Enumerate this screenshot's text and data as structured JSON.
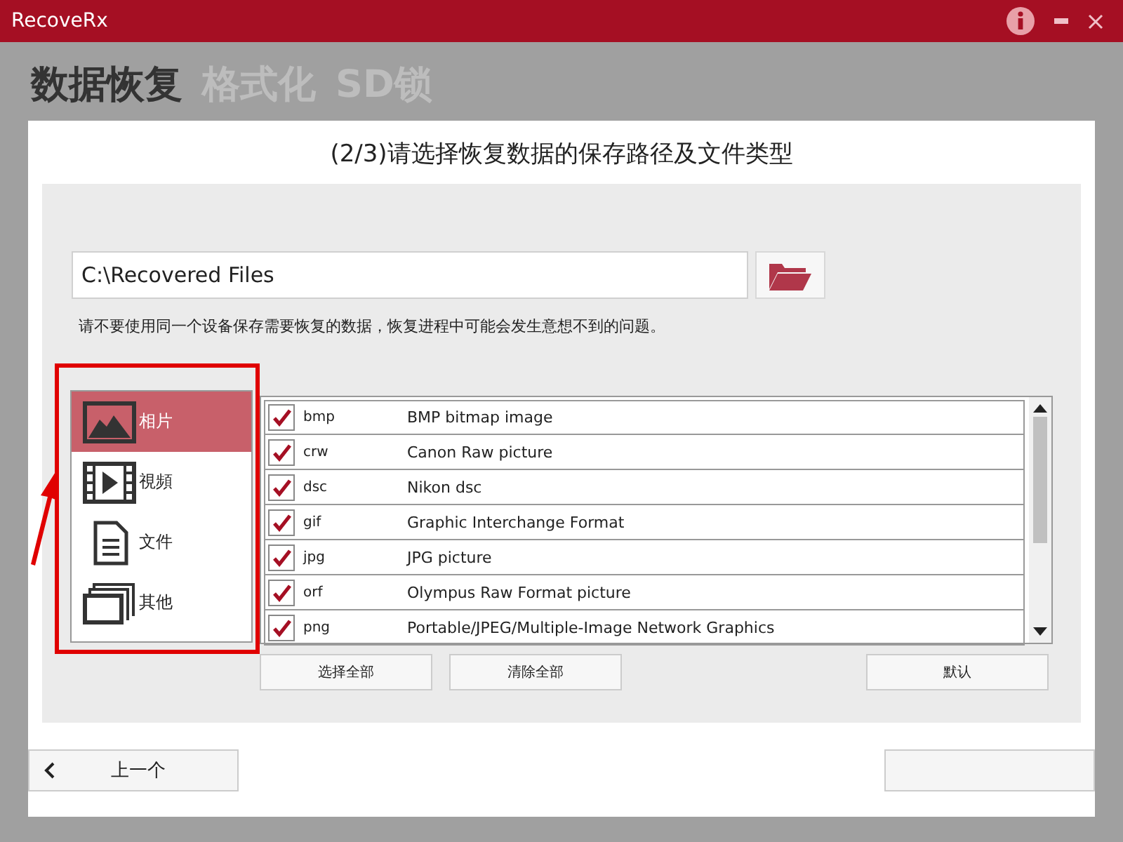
{
  "window": {
    "title": "RecoveRx"
  },
  "tabs": [
    {
      "label": "数据恢复",
      "selected": true
    },
    {
      "label": "格式化",
      "selected": false
    },
    {
      "label": "SD锁",
      "selected": false
    }
  ],
  "step_title": "(2/3)请选择恢复数据的保存路径及文件类型",
  "path_field": {
    "value": "C:\\Recovered Files"
  },
  "hint": "请不要使用同一个设备保存需要恢复的数据，恢复进程中可能会发生意想不到的问题。",
  "categories": [
    {
      "kind": "photo",
      "label": "相片",
      "selected": true
    },
    {
      "kind": "video",
      "label": "視頻",
      "selected": false
    },
    {
      "kind": "document",
      "label": "文件",
      "selected": false
    },
    {
      "kind": "other",
      "label": "其他",
      "selected": false
    }
  ],
  "file_types": [
    {
      "ext": "bmp",
      "description": "BMP bitmap image",
      "checked": true
    },
    {
      "ext": "crw",
      "description": "Canon Raw picture",
      "checked": true
    },
    {
      "ext": "dsc",
      "description": "Nikon dsc",
      "checked": true
    },
    {
      "ext": "gif",
      "description": "Graphic Interchange Format",
      "checked": true
    },
    {
      "ext": "jpg",
      "description": "JPG picture",
      "checked": true
    },
    {
      "ext": "orf",
      "description": "Olympus Raw Format picture",
      "checked": true
    },
    {
      "ext": "png",
      "description": "Portable/JPEG/Multiple-Image Network Graphics",
      "checked": true
    }
  ],
  "list_buttons": [
    "选择全部",
    "清除全部",
    "默认"
  ],
  "back_button": "上一个"
}
